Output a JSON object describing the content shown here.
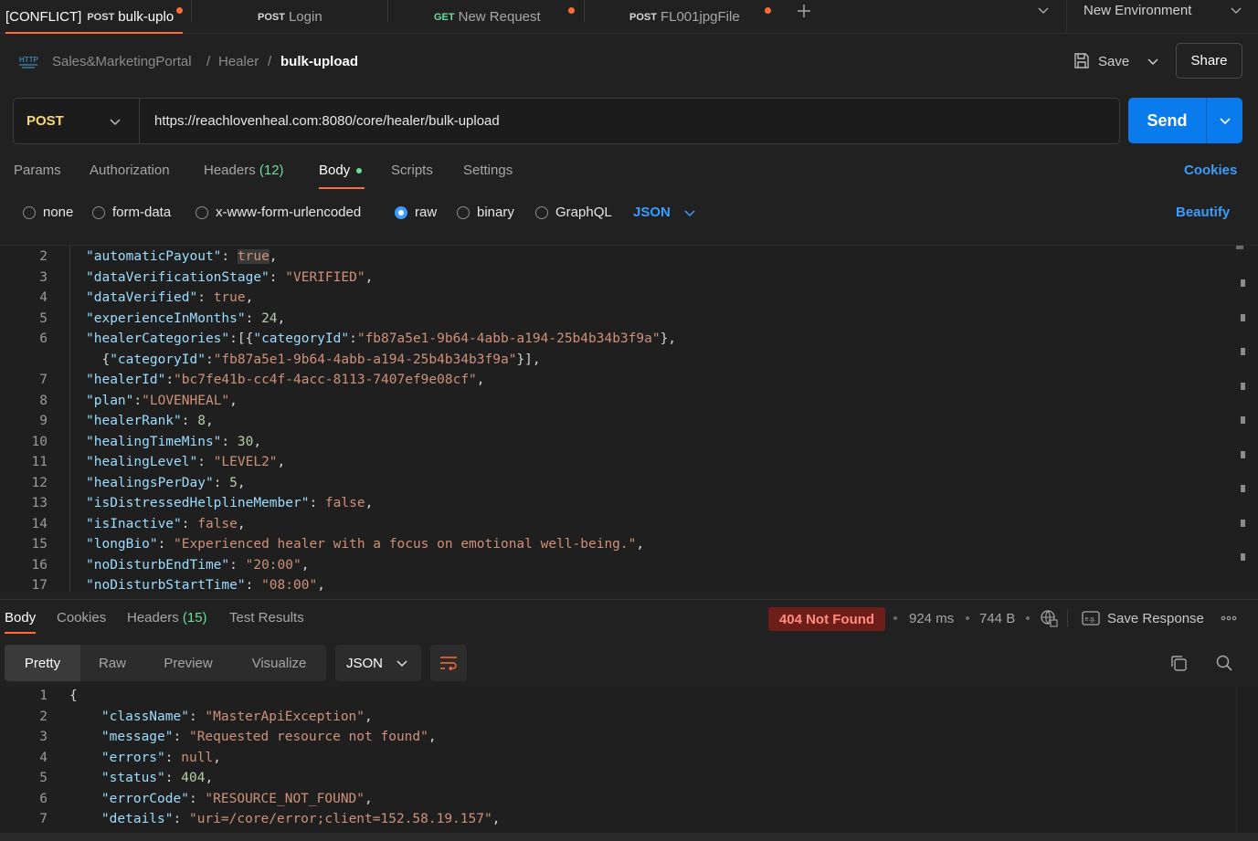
{
  "tabs": [
    {
      "prefix": "[CONFLICT]",
      "method": "POST",
      "name": "bulk-uplo",
      "unsaved": true,
      "active": true
    },
    {
      "method": "POST",
      "name": "Login",
      "unsaved": false
    },
    {
      "method": "GET",
      "name": "New Request",
      "unsaved": true
    },
    {
      "method": "POST",
      "name": "FL001jpgFile",
      "unsaved": true
    }
  ],
  "environment": "New Environment",
  "breadcrumb": {
    "badge": "HTTP",
    "items": [
      "Sales&MarketingPortal",
      "Healer"
    ],
    "current": "bulk-upload",
    "separator": "/"
  },
  "actions": {
    "save": "Save",
    "share": "Share"
  },
  "request": {
    "method": "POST",
    "url": "https://reachlovenheal.com:8080/core/healer/bulk-upload",
    "send": "Send"
  },
  "req_tabs": {
    "params": "Params",
    "authorization": "Authorization",
    "headers": "Headers",
    "headers_count": "(12)",
    "body": "Body",
    "scripts": "Scripts",
    "settings": "Settings",
    "cookies": "Cookies"
  },
  "body_types": {
    "none": "none",
    "form_data": "form-data",
    "urlencoded": "x-www-form-urlencoded",
    "raw": "raw",
    "binary": "binary",
    "graphql": "GraphQL",
    "format": "JSON",
    "beautify": "Beautify",
    "selected": "raw"
  },
  "request_body_lines": [
    {
      "n": "2",
      "t": [
        [
          "k",
          "\"automaticPayout\""
        ],
        [
          "p",
          ": "
        ],
        [
          "hl",
          "true"
        ],
        [
          "p",
          ","
        ]
      ]
    },
    {
      "n": "3",
      "t": [
        [
          "k",
          "\"dataVerificationStage\""
        ],
        [
          "p",
          ": "
        ],
        [
          "s",
          "\"VERIFIED\""
        ],
        [
          "p",
          ","
        ]
      ]
    },
    {
      "n": "4",
      "t": [
        [
          "k",
          "\"dataVerified\""
        ],
        [
          "p",
          ": "
        ],
        [
          "b",
          "true"
        ],
        [
          "p",
          ","
        ]
      ]
    },
    {
      "n": "5",
      "t": [
        [
          "k",
          "\"experienceInMonths\""
        ],
        [
          "p",
          ": "
        ],
        [
          "n",
          "24"
        ],
        [
          "p",
          ","
        ]
      ]
    },
    {
      "n": "6",
      "t": [
        [
          "k",
          "\"healerCategories\""
        ],
        [
          "p",
          ":[{"
        ],
        [
          "k",
          "\"categoryId\""
        ],
        [
          "p",
          ":"
        ],
        [
          "s",
          "\"fb87a5e1-9b64-4abb-a194-25b4b34b3f9a\""
        ],
        [
          "p",
          "},"
        ]
      ]
    },
    {
      "n": "",
      "t": [
        [
          "p",
          "  {"
        ],
        [
          "k",
          "\"categoryId\""
        ],
        [
          "p",
          ":"
        ],
        [
          "s",
          "\"fb87a5e1-9b64-4abb-a194-25b4b34b3f9a\""
        ],
        [
          "p",
          "}],"
        ]
      ]
    },
    {
      "n": "7",
      "t": [
        [
          "k",
          "\"healerId\""
        ],
        [
          "p",
          ":"
        ],
        [
          "s",
          "\"bc7fe41b-cc4f-4acc-8113-7407ef9e08cf\""
        ],
        [
          "p",
          ","
        ]
      ]
    },
    {
      "n": "8",
      "t": [
        [
          "k",
          "\"plan\""
        ],
        [
          "p",
          ":"
        ],
        [
          "s",
          "\"LOVENHEAL\""
        ],
        [
          "p",
          ","
        ]
      ]
    },
    {
      "n": "9",
      "t": [
        [
          "k",
          "\"healerRank\""
        ],
        [
          "p",
          ": "
        ],
        [
          "n",
          "8"
        ],
        [
          "p",
          ","
        ]
      ]
    },
    {
      "n": "10",
      "t": [
        [
          "k",
          "\"healingTimeMins\""
        ],
        [
          "p",
          ": "
        ],
        [
          "n",
          "30"
        ],
        [
          "p",
          ","
        ]
      ]
    },
    {
      "n": "11",
      "t": [
        [
          "k",
          "\"healingLevel\""
        ],
        [
          "p",
          ": "
        ],
        [
          "s",
          "\"LEVEL2\""
        ],
        [
          "p",
          ","
        ]
      ]
    },
    {
      "n": "12",
      "t": [
        [
          "k",
          "\"healingsPerDay\""
        ],
        [
          "p",
          ": "
        ],
        [
          "n",
          "5"
        ],
        [
          "p",
          ","
        ]
      ]
    },
    {
      "n": "13",
      "t": [
        [
          "k",
          "\"isDistressedHelplineMember\""
        ],
        [
          "p",
          ": "
        ],
        [
          "b",
          "false"
        ],
        [
          "p",
          ","
        ]
      ]
    },
    {
      "n": "14",
      "t": [
        [
          "k",
          "\"isInactive\""
        ],
        [
          "p",
          ": "
        ],
        [
          "b",
          "false"
        ],
        [
          "p",
          ","
        ]
      ]
    },
    {
      "n": "15",
      "t": [
        [
          "k",
          "\"longBio\""
        ],
        [
          "p",
          ": "
        ],
        [
          "s",
          "\"Experienced healer with a focus on emotional well-being.\""
        ],
        [
          "p",
          ","
        ]
      ]
    },
    {
      "n": "16",
      "t": [
        [
          "k",
          "\"noDisturbEndTime\""
        ],
        [
          "p",
          ": "
        ],
        [
          "s",
          "\"20:00\""
        ],
        [
          "p",
          ","
        ]
      ]
    },
    {
      "n": "17",
      "t": [
        [
          "k",
          "\"noDisturbStartTime\""
        ],
        [
          "p",
          ": "
        ],
        [
          "s",
          "\"08:00\""
        ],
        [
          "p",
          ","
        ]
      ]
    }
  ],
  "response": {
    "tabs": {
      "body": "Body",
      "cookies": "Cookies",
      "headers": "Headers",
      "headers_count": "(15)",
      "tests": "Test Results"
    },
    "status": "404 Not Found",
    "time": "924 ms",
    "size": "744 B",
    "save_response": "Save Response",
    "views": {
      "pretty": "Pretty",
      "raw": "Raw",
      "preview": "Preview",
      "visualize": "Visualize",
      "format": "JSON"
    },
    "lines": [
      {
        "n": "1",
        "t": [
          [
            "p",
            "{"
          ]
        ]
      },
      {
        "n": "2",
        "t": [
          [
            "p",
            "    "
          ],
          [
            "k",
            "\"className\""
          ],
          [
            "p",
            ": "
          ],
          [
            "s",
            "\"MasterApiException\""
          ],
          [
            "p",
            ","
          ]
        ]
      },
      {
        "n": "3",
        "t": [
          [
            "p",
            "    "
          ],
          [
            "k",
            "\"message\""
          ],
          [
            "p",
            ": "
          ],
          [
            "s",
            "\"Requested resource not found\""
          ],
          [
            "p",
            ","
          ]
        ]
      },
      {
        "n": "4",
        "t": [
          [
            "p",
            "    "
          ],
          [
            "k",
            "\"errors\""
          ],
          [
            "p",
            ": "
          ],
          [
            "b",
            "null"
          ],
          [
            "p",
            ","
          ]
        ]
      },
      {
        "n": "5",
        "t": [
          [
            "p",
            "    "
          ],
          [
            "k",
            "\"status\""
          ],
          [
            "p",
            ": "
          ],
          [
            "n",
            "404"
          ],
          [
            "p",
            ","
          ]
        ]
      },
      {
        "n": "6",
        "t": [
          [
            "p",
            "    "
          ],
          [
            "k",
            "\"errorCode\""
          ],
          [
            "p",
            ": "
          ],
          [
            "s",
            "\"RESOURCE_NOT_FOUND\""
          ],
          [
            "p",
            ","
          ]
        ]
      },
      {
        "n": "7",
        "t": [
          [
            "p",
            "    "
          ],
          [
            "k",
            "\"details\""
          ],
          [
            "p",
            ": "
          ],
          [
            "s",
            "\"uri=/core/error;client=152.58.19.157\""
          ],
          [
            "p",
            ","
          ]
        ]
      }
    ]
  },
  "colors": {
    "accent": "#ff6c37",
    "send": "#097bed",
    "link": "#3b9cff",
    "status_bg": "#6e1e18"
  }
}
